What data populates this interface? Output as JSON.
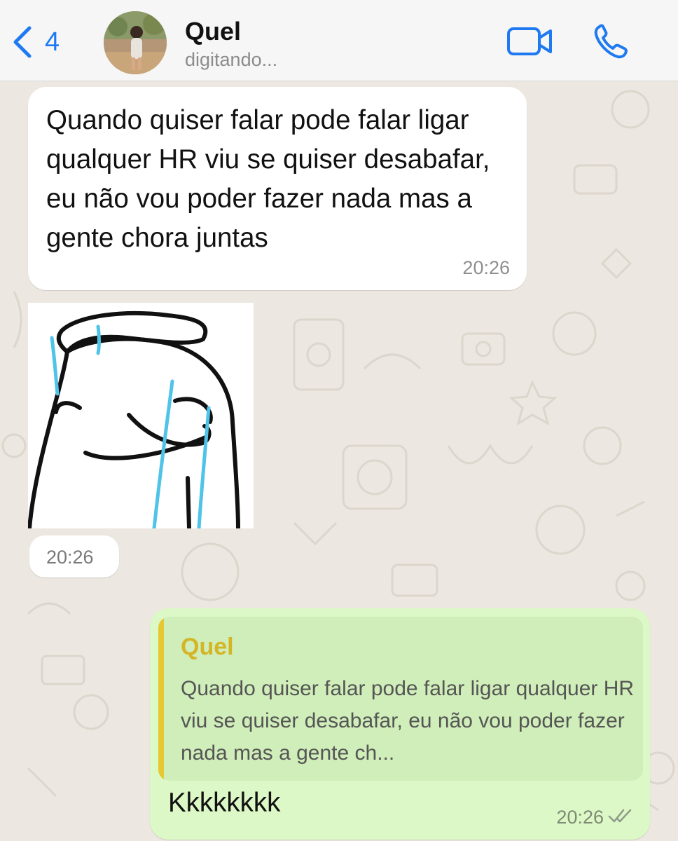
{
  "header": {
    "back_count": "4",
    "contact_name": "Quel",
    "status": "digitando...",
    "accent_color": "#1f7af1"
  },
  "messages": [
    {
      "direction": "incoming",
      "type": "text",
      "text": "Quando quiser falar pode falar ligar qualquer HR viu se quiser desabafar, eu não vou poder fazer nada mas a gente chora juntas",
      "time": "20:26"
    },
    {
      "direction": "incoming",
      "type": "sticker",
      "sticker_description": "crying-blob-sticker",
      "time": "20:26"
    },
    {
      "direction": "outgoing",
      "type": "reply",
      "quote_author": "Quel",
      "quote_text": "Quando quiser falar pode falar ligar qualquer HR viu se quiser desabafar, eu não vou poder fazer nada mas a gente ch...",
      "text": "Kkkkkkkk",
      "time": "20:26",
      "status_icon": "double-check-icon"
    }
  ],
  "colors": {
    "incoming_bubble": "#ffffff",
    "outgoing_bubble": "#dcf8c6",
    "quote_accent": "#e5c832",
    "chat_background": "#ece7e0"
  }
}
